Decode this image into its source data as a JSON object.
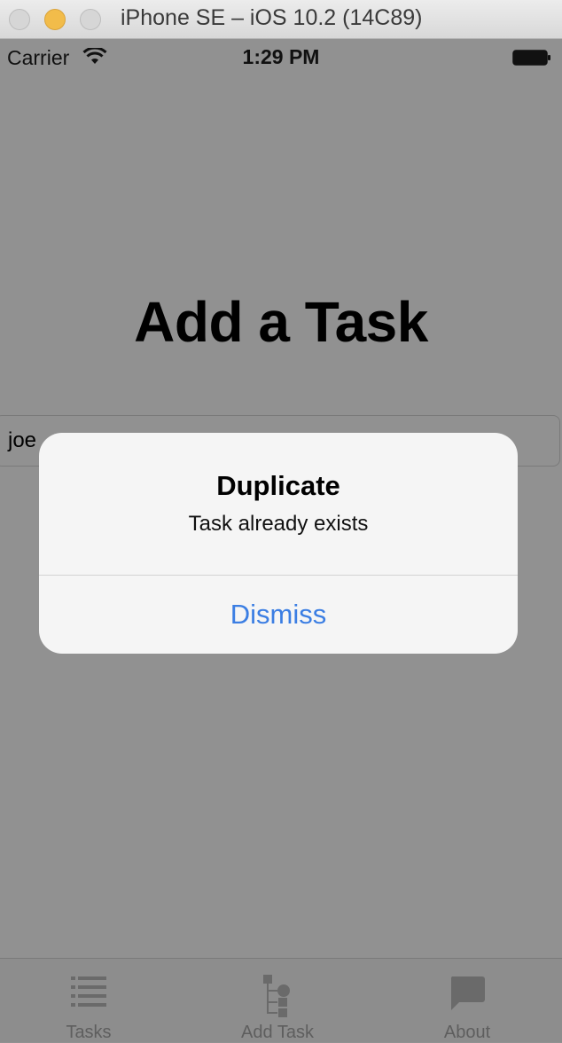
{
  "window": {
    "title": "iPhone SE – iOS 10.2 (14C89)"
  },
  "status_bar": {
    "carrier": "Carrier",
    "time": "1:29 PM"
  },
  "page": {
    "heading": "Add a Task"
  },
  "task_input": {
    "value": "joe"
  },
  "alert": {
    "title": "Duplicate",
    "message": "Task already exists",
    "dismiss_label": "Dismiss",
    "accent_color": "#3b7ee3"
  },
  "tabs": [
    {
      "label": "Tasks",
      "icon": "list-icon"
    },
    {
      "label": "Add Task",
      "icon": "tree-icon"
    },
    {
      "label": "About",
      "icon": "speech-bubble-icon"
    }
  ]
}
